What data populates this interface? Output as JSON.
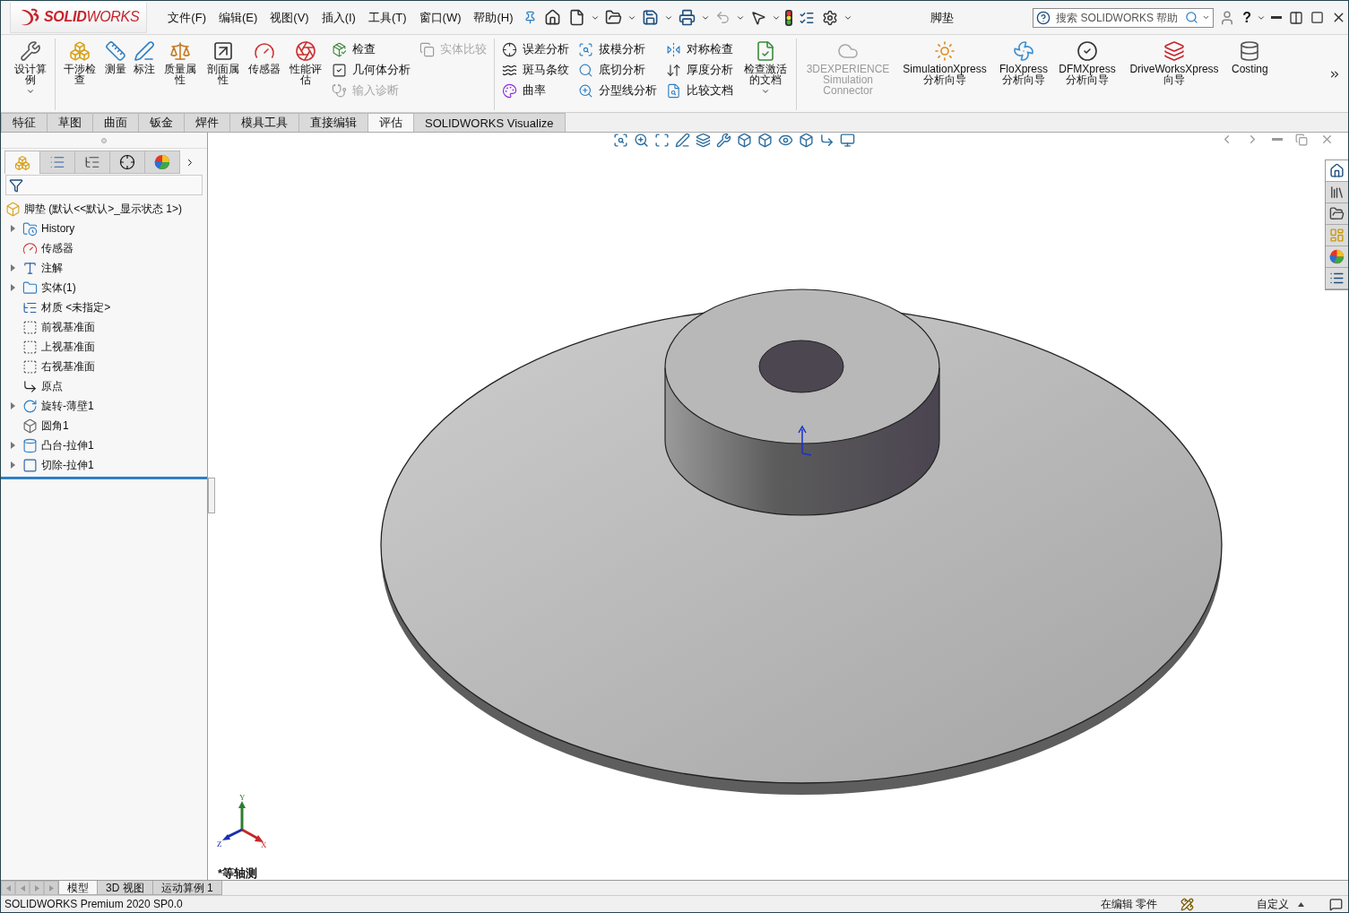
{
  "title_bar": {
    "logo": "**SOLID**WORKS",
    "menus": [
      "文件(F)",
      "编辑(E)",
      "视图(V)",
      "插入(I)",
      "工具(T)",
      "窗口(W)",
      "帮助(H)"
    ],
    "document_title": "脚垫",
    "search": {
      "placeholder": "搜索 SOLIDWORKS 帮助"
    },
    "help": "?"
  },
  "ribbon": {
    "groups": [
      [
        {
          "kind": "large",
          "label": "设计算例",
          "dropdown": true,
          "disabled": false
        }
      ],
      [
        {
          "kind": "large",
          "label": "干涉检查",
          "dropdown": false,
          "disabled": false
        },
        {
          "kind": "large",
          "label": "测量",
          "dropdown": false,
          "disabled": false
        },
        {
          "kind": "large",
          "label": "标注",
          "dropdown": false,
          "disabled": false
        },
        {
          "kind": "large",
          "label": "质量属性",
          "dropdown": false,
          "disabled": false
        },
        {
          "kind": "large",
          "label": "剖面属性",
          "dropdown": false,
          "disabled": false
        },
        {
          "kind": "large",
          "label": "传感器",
          "dropdown": false,
          "disabled": false
        },
        {
          "kind": "large",
          "label": "性能评估",
          "dropdown": false,
          "disabled": false
        },
        {
          "kind": "stack",
          "items": [
            {
              "label": "检查",
              "disabled": false
            },
            {
              "label": "几何体分析",
              "disabled": false
            },
            {
              "label": "输入诊断",
              "disabled": true
            }
          ]
        },
        {
          "kind": "stack",
          "items": [
            {
              "label": "实体比较",
              "disabled": true
            }
          ]
        }
      ],
      [
        {
          "kind": "stack",
          "items": [
            {
              "label": "误差分析",
              "disabled": false
            },
            {
              "label": "斑马条纹",
              "disabled": false
            },
            {
              "label": "曲率",
              "disabled": false
            }
          ]
        },
        {
          "kind": "stack",
          "items": [
            {
              "label": "拔模分析",
              "disabled": false
            },
            {
              "label": "底切分析",
              "disabled": false
            },
            {
              "label": "分型线分析",
              "disabled": false
            }
          ]
        },
        {
          "kind": "stack",
          "items": [
            {
              "label": "对称检查",
              "disabled": false
            },
            {
              "label": "厚度分析",
              "disabled": false
            },
            {
              "label": "比较文档",
              "disabled": false
            }
          ]
        },
        {
          "kind": "large",
          "label": "检查激活的文档",
          "dropdown": true,
          "disabled": false
        }
      ],
      [
        {
          "kind": "large",
          "label": "3DEXPERIENCE Simulation Connector",
          "dropdown": false,
          "disabled": true
        },
        {
          "kind": "large",
          "label": "SimulationXpress 分析向导",
          "dropdown": false,
          "disabled": false
        },
        {
          "kind": "large",
          "label": "FloXpress 分析向导",
          "dropdown": false,
          "disabled": false
        },
        {
          "kind": "large",
          "label": "DFMXpress 分析向导",
          "dropdown": false,
          "disabled": false
        },
        {
          "kind": "large",
          "label": "DriveWorksXpress 向导",
          "dropdown": false,
          "disabled": false
        },
        {
          "kind": "large",
          "label": "Costing",
          "dropdown": false,
          "disabled": false
        }
      ]
    ]
  },
  "command_tabs": [
    {
      "label": "特征",
      "selected": false
    },
    {
      "label": "草图",
      "selected": false
    },
    {
      "label": "曲面",
      "selected": false
    },
    {
      "label": "钣金",
      "selected": false
    },
    {
      "label": "焊件",
      "selected": false
    },
    {
      "label": "模具工具",
      "selected": false
    },
    {
      "label": "直接编辑",
      "selected": false
    },
    {
      "label": "评估",
      "selected": true
    },
    {
      "label": "SOLIDWORKS Visualize",
      "selected": false
    }
  ],
  "panel_tabs": [
    {
      "kind": "feature",
      "selected": true
    },
    {
      "kind": "property",
      "selected": false
    },
    {
      "kind": "config",
      "selected": false
    },
    {
      "kind": "dimxpert",
      "selected": false
    },
    {
      "kind": "display",
      "selected": false
    }
  ],
  "feature_tree": {
    "root": {
      "label": "脚垫 (默认<<默认>_显示状态 1>)",
      "kind": "part"
    },
    "children": [
      {
        "label": "History",
        "kind": "history",
        "collapsed": true
      },
      {
        "label": "传感器",
        "kind": "sensor",
        "collapsed": false
      },
      {
        "label": "注解",
        "kind": "annotation",
        "collapsed": true
      },
      {
        "label": "实体(1)",
        "kind": "solid",
        "collapsed": true
      },
      {
        "label": "材质 <未指定>",
        "kind": "material",
        "collapsed": false
      },
      {
        "label": "前视基准面",
        "kind": "plane",
        "collapsed": false
      },
      {
        "label": "上视基准面",
        "kind": "plane",
        "collapsed": false
      },
      {
        "label": "右视基准面",
        "kind": "plane",
        "collapsed": false
      },
      {
        "label": "原点",
        "kind": "origin",
        "collapsed": false
      },
      {
        "label": "旋转-薄壁1",
        "kind": "revolve",
        "collapsed": true
      },
      {
        "label": "圆角1",
        "kind": "fillet",
        "collapsed": false
      },
      {
        "label": "凸台-拉伸1",
        "kind": "boss",
        "collapsed": true
      },
      {
        "label": "切除-拉伸1",
        "kind": "cut",
        "collapsed": true
      }
    ]
  },
  "viewport": {
    "view_label": "*等轴测",
    "triad": {
      "x": "X",
      "y": "Y",
      "z": "Z"
    }
  },
  "bottom_tabs": [
    {
      "label": "模型",
      "selected": true
    },
    {
      "label": "3D 视图",
      "selected": false
    },
    {
      "label": "运动算例 1",
      "selected": false
    }
  ],
  "status_bar": {
    "product": "SOLIDWORKS Premium 2020 SP0.0",
    "mode": "在编辑 零件",
    "units": "自定义"
  }
}
